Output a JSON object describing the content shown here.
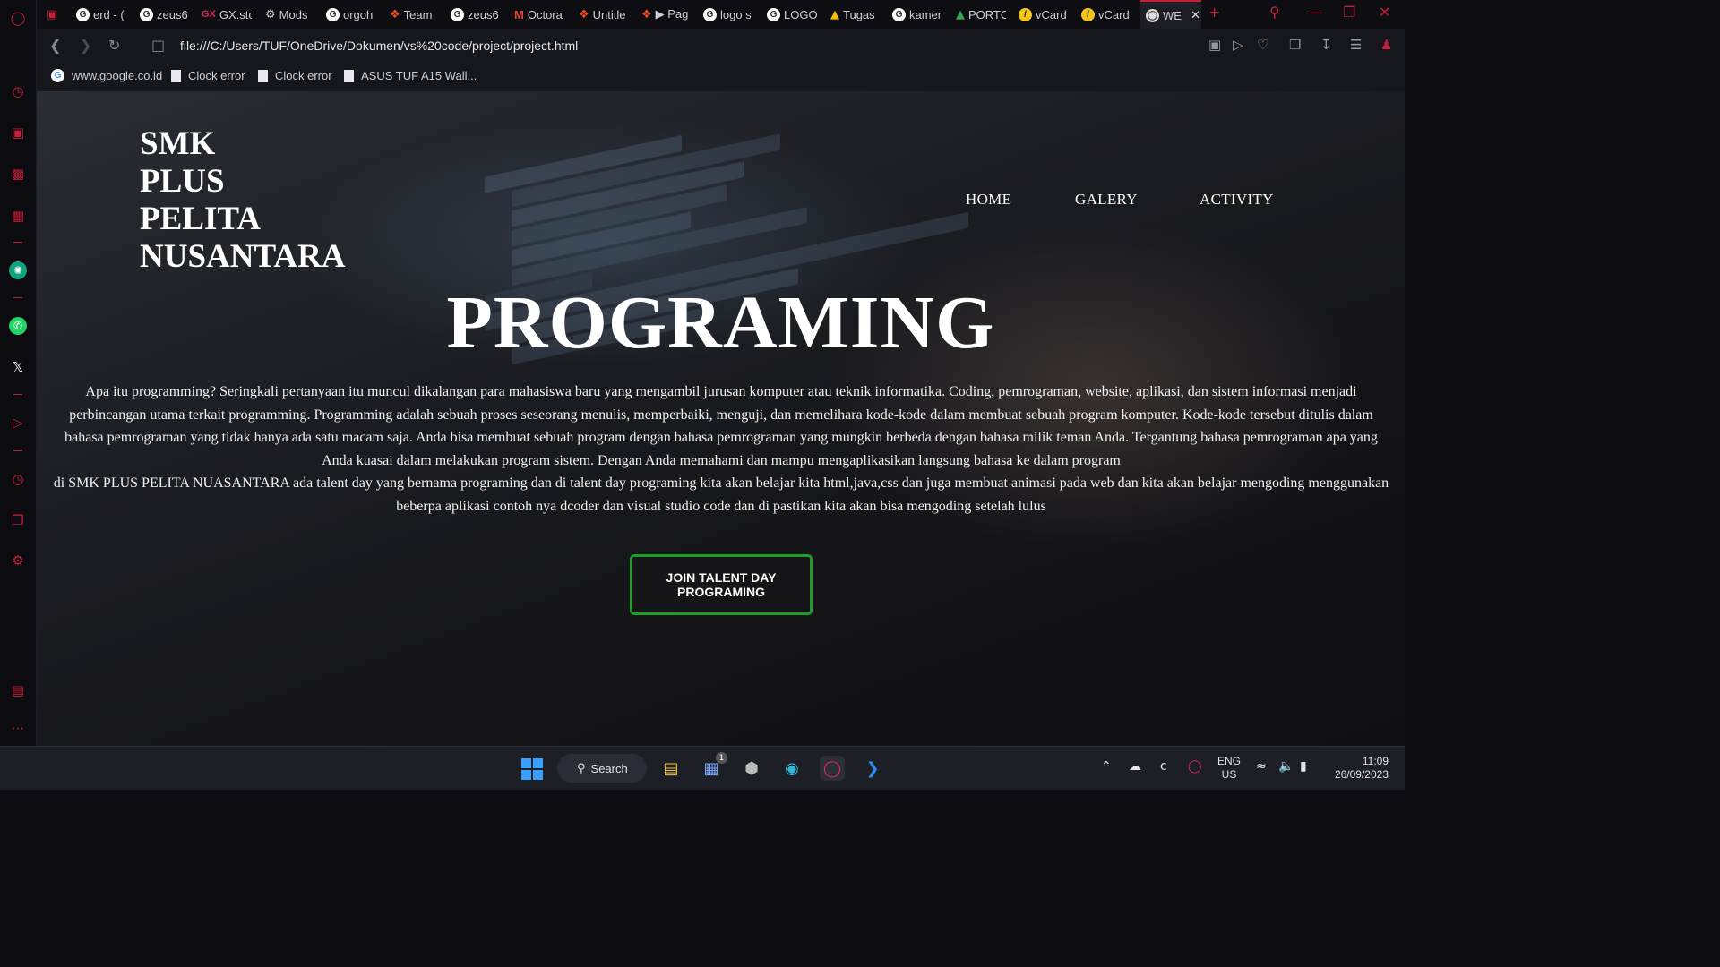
{
  "browser": {
    "tabs": [
      {
        "label": "erd - (",
        "icon": "google-icon"
      },
      {
        "label": "zeus6",
        "icon": "google-icon"
      },
      {
        "label": "GX.sto",
        "icon": "gx-store-icon"
      },
      {
        "label": "Mods",
        "icon": "gear-icon"
      },
      {
        "label": "orgoh",
        "icon": "google-icon"
      },
      {
        "label": "Team",
        "icon": "figma-icon"
      },
      {
        "label": "zeus6",
        "icon": "google-icon"
      },
      {
        "label": "Octora",
        "icon": "gmail-icon"
      },
      {
        "label": "Untitle",
        "icon": "figma-icon"
      },
      {
        "label": "▶ Pag",
        "icon": "figma-icon"
      },
      {
        "label": "logo s",
        "icon": "google-icon"
      },
      {
        "label": "LOGO",
        "icon": "google-icon"
      },
      {
        "label": "Tugas",
        "icon": "drive-icon"
      },
      {
        "label": "kamen",
        "icon": "google-icon"
      },
      {
        "label": "PORTC",
        "icon": "drive-icon"
      },
      {
        "label": "vCard",
        "icon": "vcard-icon"
      },
      {
        "label": "vCard",
        "icon": "vcard-icon"
      },
      {
        "label": "WE",
        "icon": "globe-icon",
        "active": true
      }
    ],
    "address": "file:///C:/Users/TUF/OneDrive/Dokumen/vs%20code/project/project.html",
    "bookmarks": [
      {
        "label": "www.google.co.id",
        "icon": "google-icon"
      },
      {
        "label": "Clock error",
        "icon": "page-icon"
      },
      {
        "label": "Clock error",
        "icon": "page-icon"
      },
      {
        "label": "ASUS TUF A15 Wall...",
        "icon": "page-icon"
      }
    ],
    "accent_color": "#c4203a"
  },
  "page": {
    "brand_lines": [
      "SMK",
      "PLUS",
      "PELITA",
      "NUSANTARA"
    ],
    "nav": {
      "home": "HOME",
      "galery": "GALERY",
      "activity": "ACTIVITY"
    },
    "hero_title": "PROGRAMING",
    "paragraph": [
      "Apa itu programming? Seringkali pertanyaan itu muncul dikalangan para mahasiswa baru yang mengambil jurusan komputer atau teknik informatika. Coding, pemrograman, website, aplikasi, dan sistem informasi menjadi",
      "perbincangan utama terkait programming. Programming adalah sebuah proses seseorang menulis, memperbaiki, menguji, dan memelihara kode-kode dalam membuat sebuah program komputer. Kode-kode tersebut ditulis dalam",
      "bahasa pemrograman yang tidak hanya ada satu macam saja. Anda bisa membuat sebuah program dengan bahasa pemrograman yang mungkin berbeda dengan bahasa milik teman Anda. Tergantung bahasa pemrograman apa yang",
      "Anda kuasai dalam melakukan program sistem. Dengan Anda memahami dan mampu mengaplikasikan langsung bahasa ke dalam program",
      "di SMK PLUS PELITA NUASANTARA ada talent day yang bernama programing dan di talent day programing kita akan belajar kita html,java,css dan juga membuat animasi pada web dan kita akan belajar mengoding menggunakan",
      "beberpa aplikasi contoh nya dcoder dan visual studio code dan di pastikan kita akan bisa mengoding setelah lulus"
    ],
    "cta_label": "JOIN TALENT DAY PROGRAMING",
    "cta_border_color": "#1f9d2a"
  },
  "taskbar": {
    "search_label": "Search",
    "store_badge": "1",
    "lang_line1": "ENG",
    "lang_line2": "US",
    "time": "11:09",
    "date": "26/09/2023"
  }
}
